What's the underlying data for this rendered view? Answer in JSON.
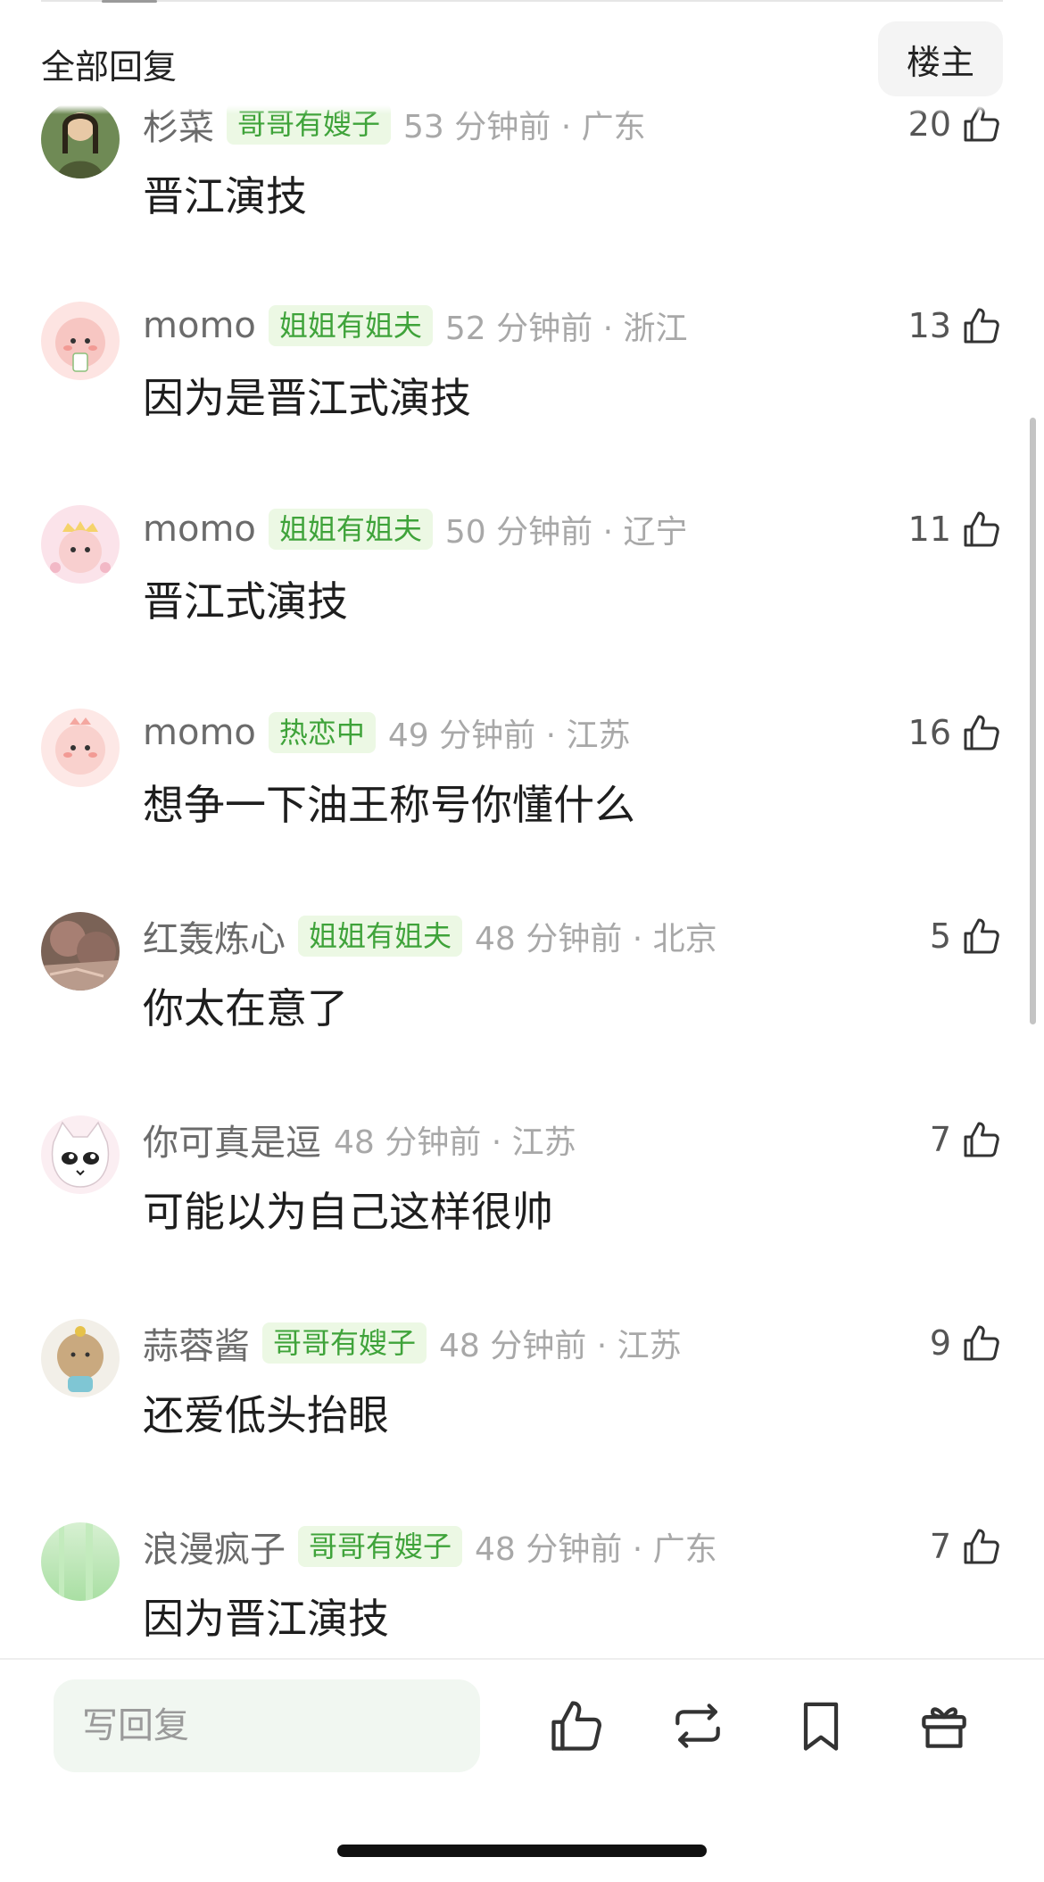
{
  "header": {
    "title": "全部回复",
    "op_button": "楼主"
  },
  "comments": [
    {
      "name": "杉菜",
      "badge": "哥哥有嫂子",
      "time": "53 分钟前 · 广东",
      "likes": "20",
      "text": "晋江演技"
    },
    {
      "name": "momo",
      "badge": "姐姐有姐夫",
      "time": "52 分钟前 · 浙江",
      "likes": "13",
      "text": "因为是晋江式演技"
    },
    {
      "name": "momo",
      "badge": "姐姐有姐夫",
      "time": "50 分钟前 · 辽宁",
      "likes": "11",
      "text": "晋江式演技"
    },
    {
      "name": "momo",
      "badge": "热恋中",
      "time": "49 分钟前 · 江苏",
      "likes": "16",
      "text": "想争一下油王称号你懂什么"
    },
    {
      "name": "红轰炼心",
      "badge": "姐姐有姐夫",
      "time": "48 分钟前 · 北京",
      "likes": "5",
      "text": "你太在意了"
    },
    {
      "name": "你可真是逗",
      "badge": "",
      "time": "48 分钟前 · 江苏",
      "likes": "7",
      "text": "可能以为自己这样很帅"
    },
    {
      "name": "蒜蓉酱",
      "badge": "哥哥有嫂子",
      "time": "48 分钟前 · 江苏",
      "likes": "9",
      "text": "还爱低头抬眼"
    },
    {
      "name": "浪漫疯子",
      "badge": "哥哥有嫂子",
      "time": "48 分钟前 · 广东",
      "likes": "7",
      "text": "因为晋江演技"
    }
  ],
  "bottom_bar": {
    "reply_placeholder": "写回复"
  },
  "colors": {
    "badge_bg": "#ecf8e4",
    "badge_text": "#3fa33a",
    "meta_gray": "#a8a8a8"
  }
}
